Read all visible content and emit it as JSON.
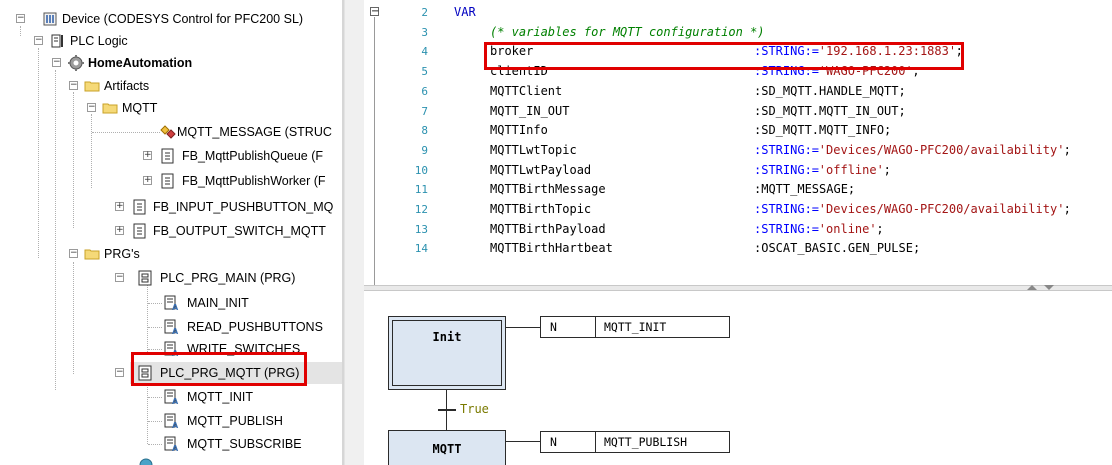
{
  "tree": {
    "items": [
      {
        "label": "Device (CODESYS Control for PFC200 SL)",
        "expander": "−",
        "icon": "device-icon"
      },
      {
        "label": "PLC Logic",
        "expander": "−",
        "icon": "plc-logic-icon"
      },
      {
        "label": "HomeAutomation",
        "expander": "−",
        "icon": "application-gear-icon"
      },
      {
        "label": "Artifacts",
        "expander": "−",
        "icon": "folder-icon"
      },
      {
        "label": "MQTT",
        "expander": "−",
        "icon": "folder-icon"
      },
      {
        "label": "MQTT_MESSAGE (STRUC",
        "expander": "",
        "icon": "struct-icon"
      },
      {
        "label": "FB_MqttPublishQueue (F",
        "expander": "+",
        "icon": "function-block-icon"
      },
      {
        "label": "FB_MqttPublishWorker (F",
        "expander": "+",
        "icon": "function-block-icon"
      },
      {
        "label": "FB_INPUT_PUSHBUTTON_MQ",
        "expander": "+",
        "icon": "function-block-icon"
      },
      {
        "label": "FB_OUTPUT_SWITCH_MQTT",
        "expander": "+",
        "icon": "function-block-icon"
      },
      {
        "label": "PRG's",
        "expander": "−",
        "icon": "folder-icon"
      },
      {
        "label": "PLC_PRG_MAIN (PRG)",
        "expander": "−",
        "icon": "program-icon"
      },
      {
        "label": "MAIN_INIT",
        "expander": "",
        "icon": "action-icon"
      },
      {
        "label": "READ_PUSHBUTTONS",
        "expander": "",
        "icon": "action-icon"
      },
      {
        "label": "WRITE_SWITCHES",
        "expander": "",
        "icon": "action-icon"
      },
      {
        "label": "PLC_PRG_MQTT (PRG)",
        "expander": "−",
        "icon": "program-icon"
      },
      {
        "label": "MQTT_INIT",
        "expander": "",
        "icon": "action-icon"
      },
      {
        "label": "MQTT_PUBLISH",
        "expander": "",
        "icon": "action-icon"
      },
      {
        "label": "MQTT_SUBSCRIBE",
        "expander": "",
        "icon": "action-icon"
      }
    ]
  },
  "editor": {
    "fold_symbol": "−",
    "lines": [
      {
        "num": "2",
        "keyword": "VAR",
        "comment": "",
        "name": "",
        "type": "",
        "value": "",
        "end": ""
      },
      {
        "num": "3",
        "keyword": "",
        "comment": "(* variables for MQTT configuration *)",
        "name": "",
        "type": "",
        "value": "",
        "end": ""
      },
      {
        "num": "4",
        "keyword": "",
        "comment": "",
        "name": "broker",
        "type": ":STRING:=",
        "value": "'192.168.1.23:1883'",
        "end": ";"
      },
      {
        "num": "5",
        "keyword": "",
        "comment": "",
        "name": "clientID",
        "type": ":STRING:=",
        "value": "'WAGO-PFC200'",
        "end": ";"
      },
      {
        "num": "6",
        "keyword": "",
        "comment": "",
        "name": "MQTTClient",
        "type": ":SD_MQTT.HANDLE_MQTT;",
        "value": "",
        "end": ""
      },
      {
        "num": "7",
        "keyword": "",
        "comment": "",
        "name": "MQTT_IN_OUT",
        "type": ":SD_MQTT.MQTT_IN_OUT;",
        "value": "",
        "end": ""
      },
      {
        "num": "8",
        "keyword": "",
        "comment": "",
        "name": "MQTTInfo",
        "type": ":SD_MQTT.MQTT_INFO;",
        "value": "",
        "end": ""
      },
      {
        "num": "9",
        "keyword": "",
        "comment": "",
        "name": "MQTTLwtTopic",
        "type": ":STRING:=",
        "value": "'Devices/WAGO-PFC200/availability'",
        "end": ";"
      },
      {
        "num": "10",
        "keyword": "",
        "comment": "",
        "name": "MQTTLwtPayload",
        "type": ":STRING:=",
        "value": "'offline'",
        "end": ";"
      },
      {
        "num": "11",
        "keyword": "",
        "comment": "",
        "name": "MQTTBirthMessage",
        "type": ":MQTT_MESSAGE;",
        "value": "",
        "end": ""
      },
      {
        "num": "12",
        "keyword": "",
        "comment": "",
        "name": "MQTTBirthTopic",
        "type": ":STRING:=",
        "value": "'Devices/WAGO-PFC200/availability'",
        "end": ";"
      },
      {
        "num": "13",
        "keyword": "",
        "comment": "",
        "name": "MQTTBirthPayload",
        "type": ":STRING:=",
        "value": "'online'",
        "end": ";"
      },
      {
        "num": "14",
        "keyword": "",
        "comment": "",
        "name": "MQTTBirthHartbeat",
        "type": ":OSCAT_BASIC.GEN_PULSE;",
        "value": "",
        "end": ""
      }
    ]
  },
  "sfc": {
    "steps": [
      {
        "label": "Init",
        "qualifier": "N",
        "action": "MQTT_INIT"
      },
      {
        "label": "MQTT",
        "qualifier": "N",
        "action": "MQTT_PUBLISH"
      }
    ],
    "transition": "True"
  },
  "colors": {
    "highlight": "#e00000",
    "step_fill": "#dce6f2",
    "keyword": "#0000c0",
    "comment": "#008000",
    "string": "#a31515",
    "line_number": "#2b91af"
  }
}
